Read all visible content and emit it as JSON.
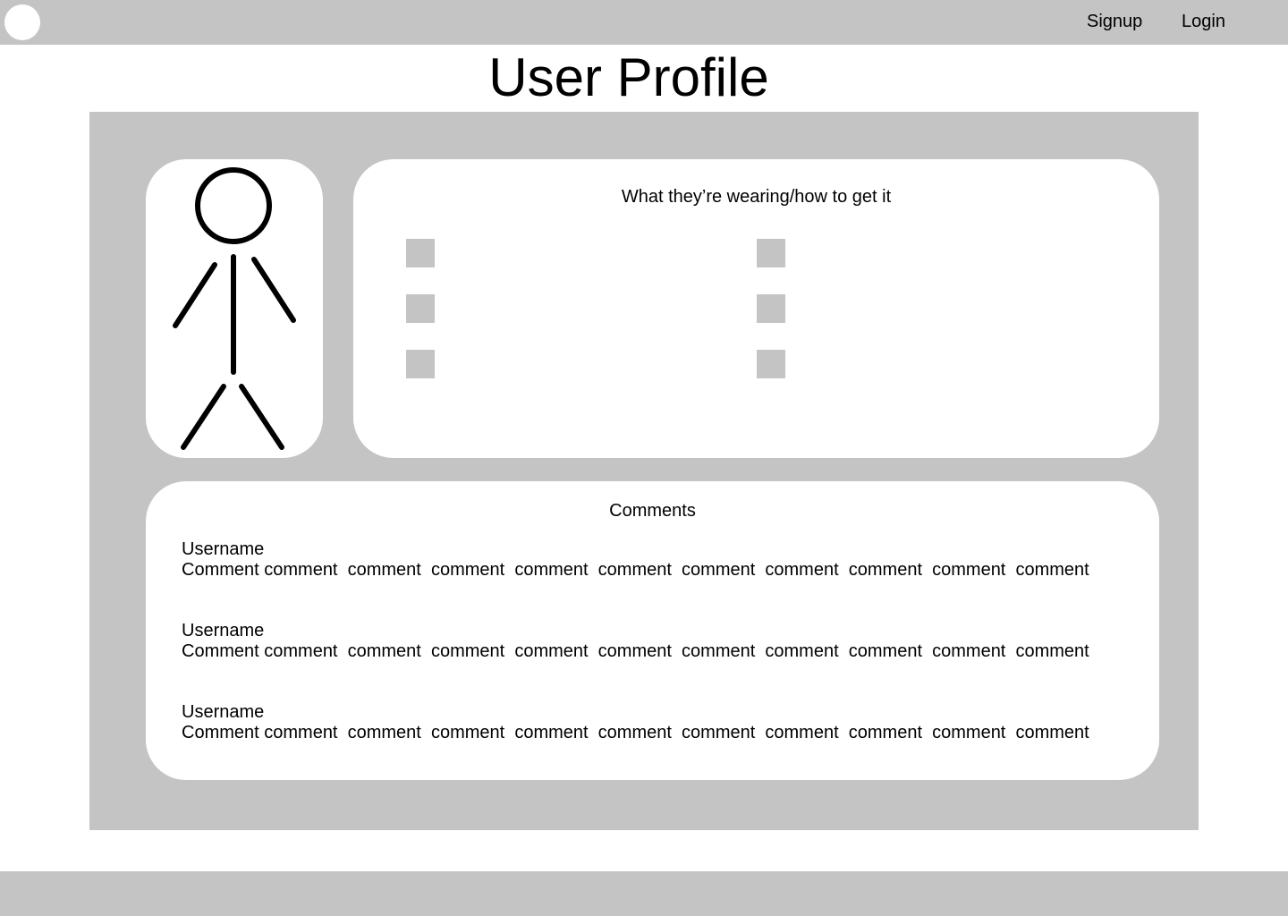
{
  "nav": {
    "signup_label": "Signup",
    "login_label": "Login"
  },
  "page": {
    "title": "User Profile"
  },
  "outfit": {
    "heading": "What they’re wearing/how to get it"
  },
  "comments": {
    "heading": "Comments",
    "items": [
      {
        "username": "Username",
        "text": "Comment comment  comment  comment  comment  comment  comment  comment  comment  comment  comment"
      },
      {
        "username": "Username",
        "text": "Comment comment  comment  comment  comment  comment  comment  comment  comment  comment  comment"
      },
      {
        "username": "Username",
        "text": "Comment comment  comment  comment  comment  comment  comment  comment  comment  comment  comment"
      }
    ]
  },
  "colors": {
    "panel_gray": "#c4c4c4",
    "card_white": "#ffffff",
    "text": "#000000"
  },
  "icons": {
    "logo": "circle-logo-icon",
    "avatar": "stick-figure-icon",
    "outfit_item": "placeholder-square-icon"
  }
}
